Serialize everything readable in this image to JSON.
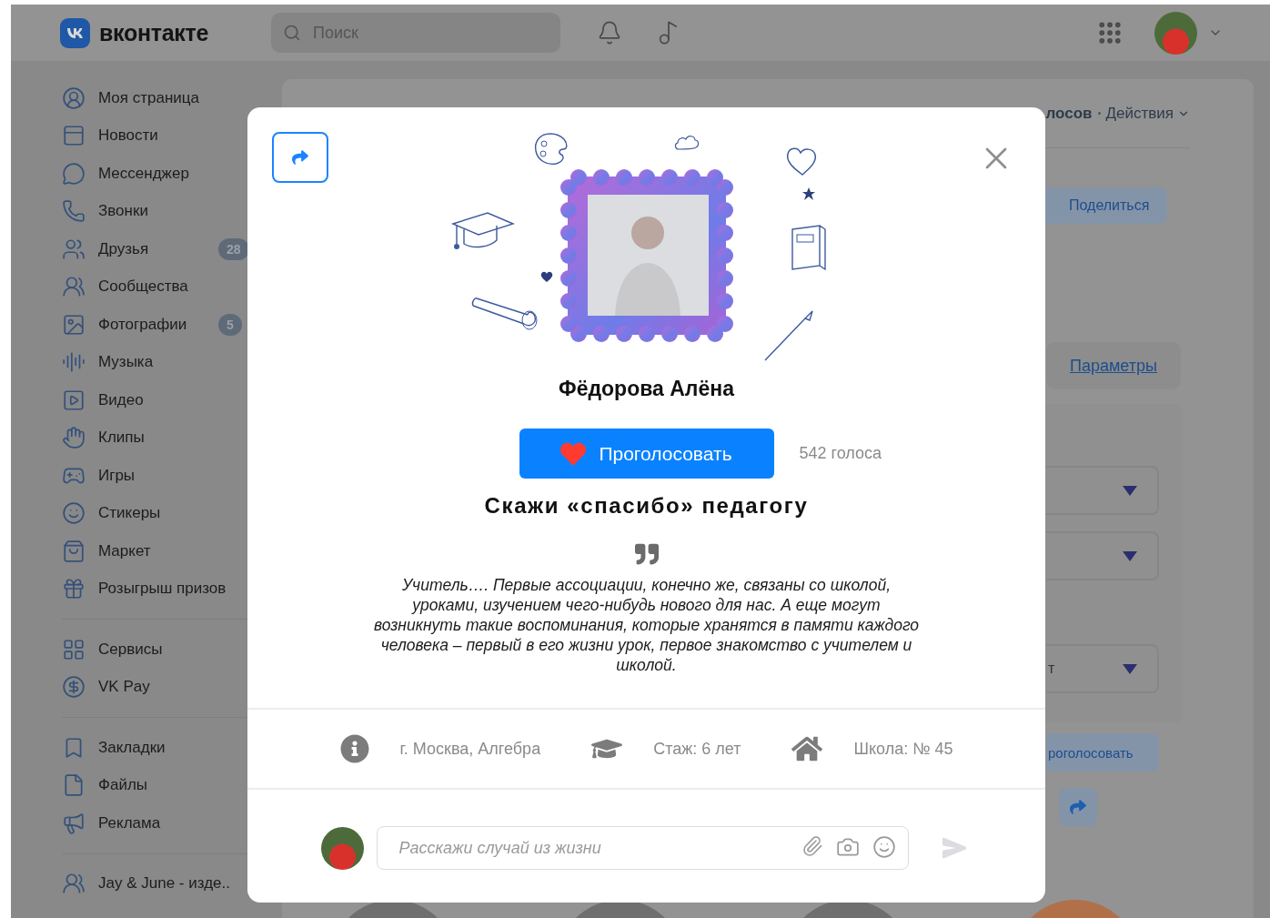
{
  "header": {
    "logo_text": "вконтакте",
    "search": {
      "placeholder": "Поиск"
    }
  },
  "sidebar": {
    "groups": [
      [
        {
          "label": "Моя страница"
        },
        {
          "label": "Новости"
        },
        {
          "label": "Мессенджер"
        },
        {
          "label": "Звонки"
        },
        {
          "label": "Друзья",
          "badge": "28"
        },
        {
          "label": "Сообщества"
        },
        {
          "label": "Фотографии",
          "badge": "5"
        },
        {
          "label": "Музыка"
        },
        {
          "label": "Видео"
        },
        {
          "label": "Клипы"
        },
        {
          "label": "Игры"
        },
        {
          "label": "Стикеры"
        },
        {
          "label": "Маркет"
        },
        {
          "label": "Розыгрыш призов"
        }
      ],
      [
        {
          "label": "Сервисы"
        },
        {
          "label": "VK Pay"
        }
      ],
      [
        {
          "label": "Закладки"
        },
        {
          "label": "Файлы"
        },
        {
          "label": "Реклама"
        }
      ],
      [
        {
          "label": "Jay & June - изде.."
        }
      ]
    ]
  },
  "background": {
    "votes_text": "лосов",
    "actions_label": "Действия",
    "share_button": "Поделиться",
    "params_link": "Параметры",
    "dropdowns": [
      {
        "kind": "select"
      },
      {
        "kind": "select"
      },
      {
        "kind": "select",
        "value": "т"
      }
    ],
    "vote_button": "роголосовать"
  },
  "modal": {
    "name": "Фёдорова Алёна",
    "vote_button": "Проголосовать",
    "vote_count": "542 голоса",
    "title": "Скажи «спасибо» педагогу",
    "quote": "Учитель…. Первые ассоциации, конечно же, связаны со школой, уроками, изучением чего-нибудь нового для нас. А еще могут возникнуть такие воспоминания, которые хранятся в памяти каждого человека – первый в его жизни урок, первое знакомство с учителем и школой.",
    "info": [
      {
        "kind": "info",
        "text": "г. Москва, Алгебра"
      },
      {
        "kind": "experience",
        "text": "Стаж: 6 лет"
      },
      {
        "kind": "school",
        "text": "Школа: № 45"
      }
    ],
    "comment": {
      "placeholder": "Расскажи случай из жизни"
    }
  }
}
